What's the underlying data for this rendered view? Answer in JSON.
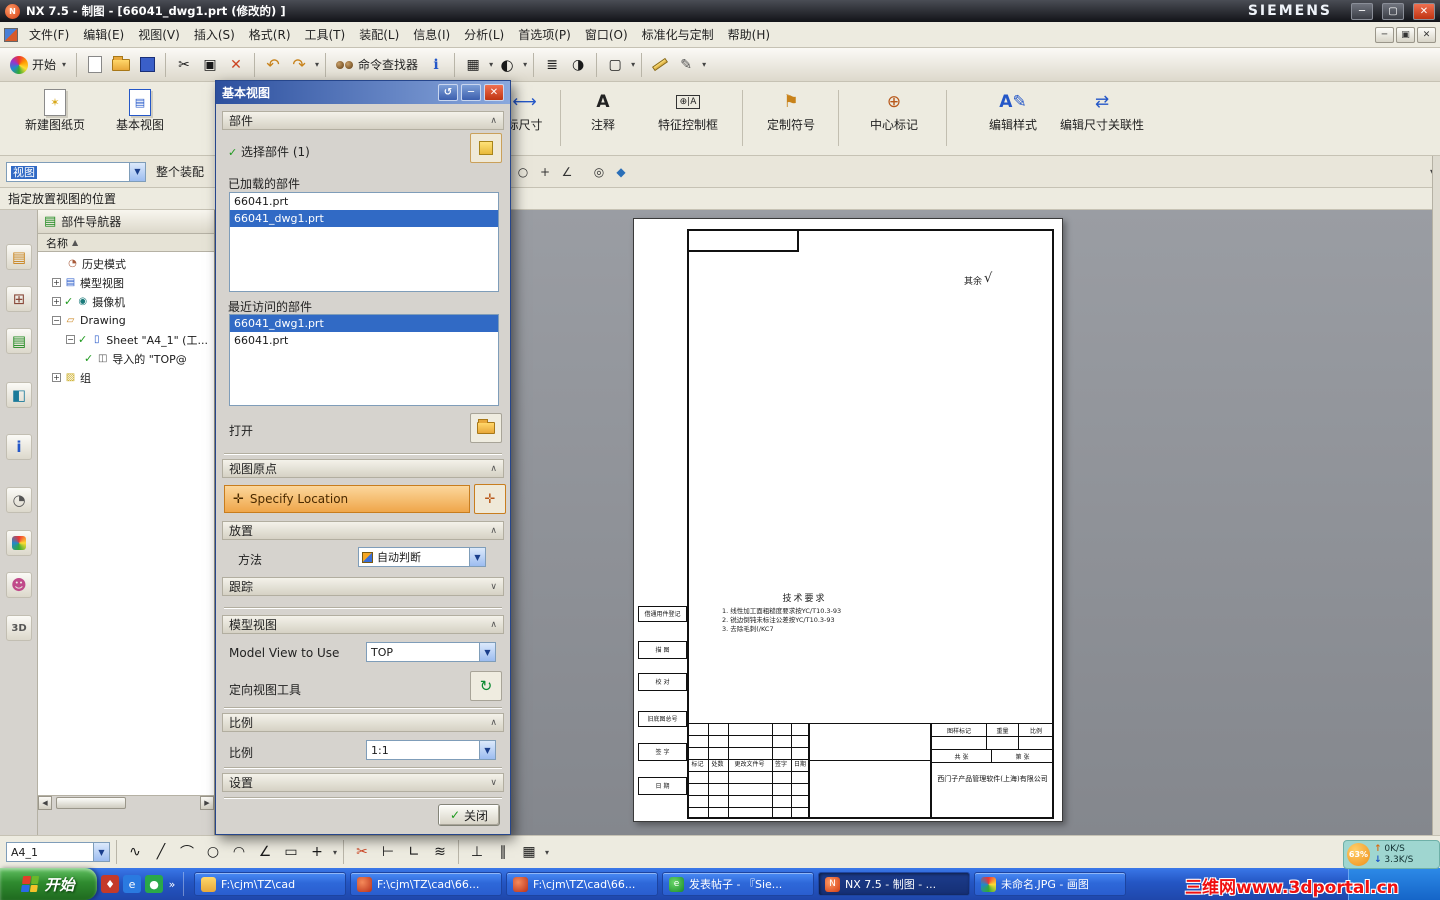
{
  "titlebar": {
    "title": "NX 7.5 - 制图 - [66041_dwg1.prt (修改的) ]",
    "brand": "SIEMENS"
  },
  "menubar": {
    "items": [
      "文件(F)",
      "编辑(E)",
      "视图(V)",
      "插入(S)",
      "格式(R)",
      "工具(T)",
      "装配(L)",
      "信息(I)",
      "分析(L)",
      "首选项(P)",
      "窗口(O)",
      "标准化与定制",
      "帮助(H)"
    ]
  },
  "toolbar": {
    "start": "开始",
    "command_finder": "命令查找器"
  },
  "ribbon": {
    "items": [
      "新建图纸页",
      "基本视图",
      "标尺寸",
      "注释",
      "特征控制框",
      "定制符号",
      "中心标记",
      "编辑样式",
      "编辑尺寸关联性"
    ]
  },
  "viewbar": {
    "view_combo": "视图",
    "scope": "整个装配"
  },
  "prompt": "指定放置视图的位置",
  "navigator": {
    "title": "部件导航器",
    "name_col": "名称",
    "rows": [
      {
        "label": "历史模式"
      },
      {
        "label": "模型视图"
      },
      {
        "label": "摄像机"
      },
      {
        "label": "Drawing"
      },
      {
        "label": "Sheet \"A4_1\" (工..."
      },
      {
        "label": "导入的 \"TOP@"
      },
      {
        "label": "组"
      }
    ]
  },
  "dialog": {
    "title": "基本视图",
    "part_section": "部件",
    "select_part": "选择部件 (1)",
    "loaded_label": "已加载的部件",
    "loaded": [
      "66041.prt",
      "66041_dwg1.prt"
    ],
    "recent_label": "最近访问的部件",
    "recent": [
      "66041_dwg1.prt",
      "66041.prt"
    ],
    "open_label": "打开",
    "origin_section": "视图原点",
    "specify_location": "Specify Location",
    "placement": "放置",
    "method_label": "方法",
    "method_value": "自动判断",
    "tracking": "跟踪",
    "modelview_section": "模型视图",
    "modelview_label": "Model View to Use",
    "modelview_value": "TOP",
    "orient_label": "定向视图工具",
    "scale_section": "比例",
    "scale_label": "比例",
    "scale_value": "1:1",
    "settings_section": "设置",
    "close": "关闭"
  },
  "sheet": {
    "roughness": "其余",
    "tech_title": "技术要求",
    "tech_lines": [
      "1. 线性加工面粗糙度要求按YC/T10.3-93",
      "2. 锐边倒钝未标注公差按YC/T10.3-93",
      "3. 去除毛刺(/KC7"
    ],
    "margin_labels": [
      "借通用件登记",
      "描 图",
      "校 对",
      "旧底图总号",
      "签 字",
      "日 期"
    ],
    "tb": {
      "mark": "标记",
      "count": "处数",
      "file": "更改文件号",
      "sign": "签字",
      "date": "日期",
      "stamp": "图样标记",
      "weight": "重量",
      "scale": "比例",
      "sheets": "共 张",
      "page": "第 张",
      "company": "西门子产品管理软件(上海)有限公司"
    }
  },
  "bottombar": {
    "sheet_combo": "A4_1"
  },
  "taskbar": {
    "start": "开始",
    "tasks": [
      "F:\\cjm\\TZ\\cad",
      "F:\\cjm\\TZ\\cad\\66...",
      "F:\\cjm\\TZ\\cad\\66...",
      "发表帖子 - 『Sie...",
      "NX 7.5 - 制图 - ...",
      "未命名.JPG - 画图"
    ],
    "widget": {
      "percent": "63%",
      "up": "0K/S",
      "down": "3.3K/S"
    },
    "watermark": "三维网www.3dportal.cn"
  }
}
